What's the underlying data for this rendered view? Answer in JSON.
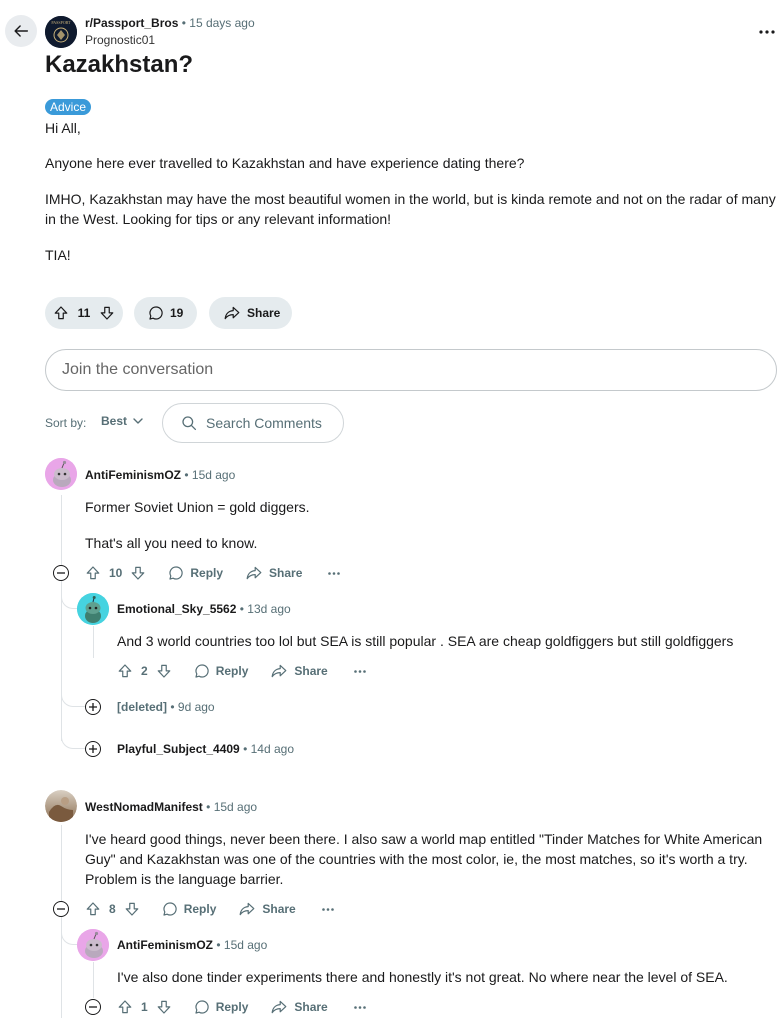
{
  "header": {
    "subreddit": "r/Passport_Bros",
    "time": "15 days ago",
    "author": "Prognostic01",
    "avatar_text": "PASSPORT"
  },
  "post": {
    "title": "Kazakhstan?",
    "flair": "Advice",
    "paragraphs": [
      "Hi All,",
      "Anyone here ever travelled to Kazakhstan and have experience dating there?",
      "IMHO, Kazakhstan may have the most beautiful women in the world, but is kinda remote and not on the radar of many in the West. Looking for tips or any relevant information!",
      "TIA!"
    ],
    "votes": "11",
    "comments": "19",
    "share_label": "Share"
  },
  "join": {
    "placeholder": "Join the conversation"
  },
  "sort": {
    "label": "Sort by:",
    "value": "Best"
  },
  "search": {
    "placeholder": "Search Comments"
  },
  "comments": [
    {
      "author": "AntiFeminismOZ",
      "time": "15d ago",
      "paragraphs": [
        "Former Soviet Union = gold diggers.",
        "That's all you need to know."
      ],
      "votes": "10",
      "reply": "Reply",
      "share": "Share"
    },
    {
      "author": "Emotional_Sky_5562",
      "time": "13d ago",
      "paragraphs": [
        "And 3 world countries too lol but SEA is still popular . SEA are cheap goldfiggers but still goldfiggers"
      ],
      "votes": "2",
      "reply": "Reply",
      "share": "Share"
    },
    {
      "author": "[deleted]",
      "time": "9d ago"
    },
    {
      "author": "Playful_Subject_4409",
      "time": "14d ago"
    },
    {
      "author": "WestNomadManifest",
      "time": "15d ago",
      "paragraphs": [
        "I've heard good things, never been there. I also saw a world map entitled \"Tinder Matches for White American Guy\" and Kazakhstan was one of the countries with the most color, ie, the most matches, so it's worth a try. Problem is the language barrier."
      ],
      "votes": "8",
      "reply": "Reply",
      "share": "Share"
    },
    {
      "author": "AntiFeminismOZ",
      "time": "15d ago",
      "paragraphs": [
        "I've also done tinder experiments there and honestly it's not great. No where near the level of SEA."
      ],
      "votes": "1",
      "reply": "Reply",
      "share": "Share"
    }
  ],
  "colors": {
    "flair": "#3a9ad9",
    "pill_bg": "#e5ebee",
    "meta": "#576f76",
    "avatar_pink": "#e9a6e8",
    "avatar_teal": "#46d3e0"
  }
}
